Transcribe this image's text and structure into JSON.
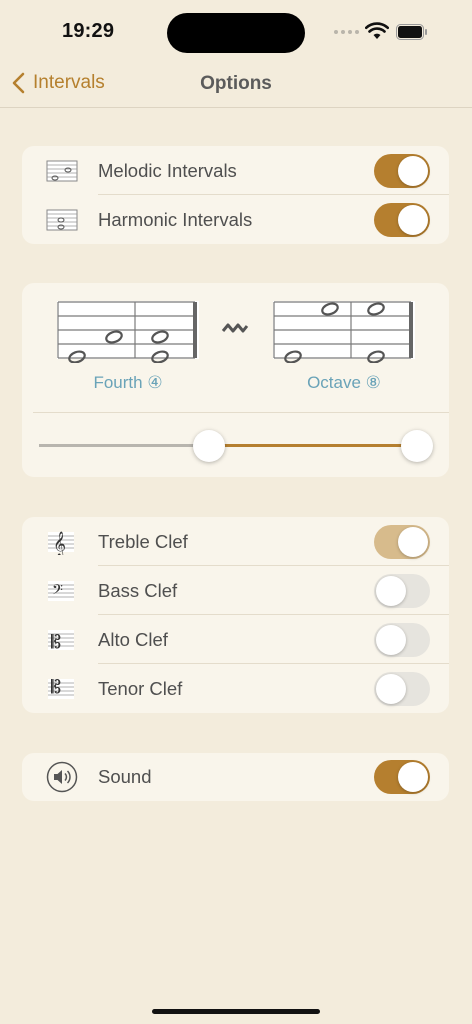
{
  "status": {
    "time": "19:29"
  },
  "nav": {
    "back_label": "Intervals",
    "title": "Options"
  },
  "interval_types": [
    {
      "label": "Melodic Intervals",
      "enabled": true
    },
    {
      "label": "Harmonic Intervals",
      "enabled": true
    }
  ],
  "range": {
    "low": {
      "name": "Fourth",
      "number": "④"
    },
    "high": {
      "name": "Octave",
      "number": "⑧"
    },
    "low_value": 0.45,
    "high_value": 1.0
  },
  "clefs": [
    {
      "label": "Treble Clef",
      "enabled": true,
      "disabled_style": true
    },
    {
      "label": "Bass Clef",
      "enabled": false
    },
    {
      "label": "Alto Clef",
      "enabled": false
    },
    {
      "label": "Tenor Clef",
      "enabled": false
    }
  ],
  "sound": {
    "label": "Sound",
    "enabled": true
  },
  "colors": {
    "accent": "#b57f2f",
    "background": "#f3ecdc",
    "card": "#f9f5eb",
    "link": "#6aa3b8"
  }
}
